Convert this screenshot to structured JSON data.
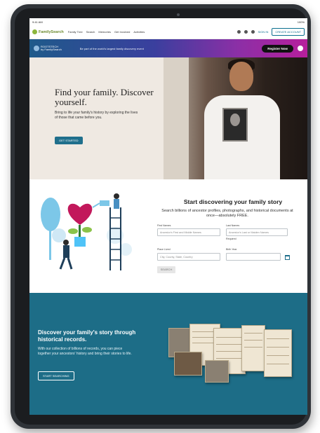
{
  "status_bar": {
    "time": "9:41 AM",
    "battery": "100%"
  },
  "nav": {
    "logo_text": "FamilySearch",
    "links": [
      "Family Tree",
      "Search",
      "Memories",
      "Get Involved",
      "Activities"
    ],
    "sign_in": "SIGN IN",
    "create_account": "CREATE ACCOUNT"
  },
  "promo": {
    "logo_line1": "ROOTSTECH",
    "logo_line2": "by FamilySearch",
    "text": "Be part of the world's largest family discovery event",
    "register_label": "Register Now"
  },
  "hero": {
    "title": "Find your family. Discover yourself.",
    "subtitle": "Bring to life your family's history by exploring the lives of those that came before you.",
    "button_label": "GET STARTED"
  },
  "discover": {
    "title": "Start discovering your family story",
    "subtitle": "Search billions of ancestor profiles, photographs, and historical documents at once—absolutely FREE.",
    "first_names_label": "First Names",
    "first_names_placeholder": "Ancestor's First and Middle Names",
    "last_names_label": "Last Names",
    "last_names_placeholder": "Ancestor's Last or Maiden Names",
    "required_note": "Required",
    "place_lived_label": "Place Lived",
    "place_lived_placeholder": "City, County, State, Country",
    "birth_year_label": "Birth Year",
    "search_label": "SEARCH"
  },
  "records": {
    "title": "Discover your family's story through historical records.",
    "subtitle": "With our collection of billions of records, you can piece together your ancestors' history and bring their stories to life.",
    "button_label": "START SEARCHING"
  },
  "colors": {
    "brand_green": "#8cb63c",
    "teal": "#1f6f8c",
    "records_bg": "#1d6d87",
    "promo_start": "#1f5a8a",
    "promo_end": "#b61f9c"
  },
  "icons": [
    "family-tree-logo-icon",
    "bell-icon",
    "help-icon",
    "menu-icon",
    "calendar-icon",
    "close-icon"
  ]
}
